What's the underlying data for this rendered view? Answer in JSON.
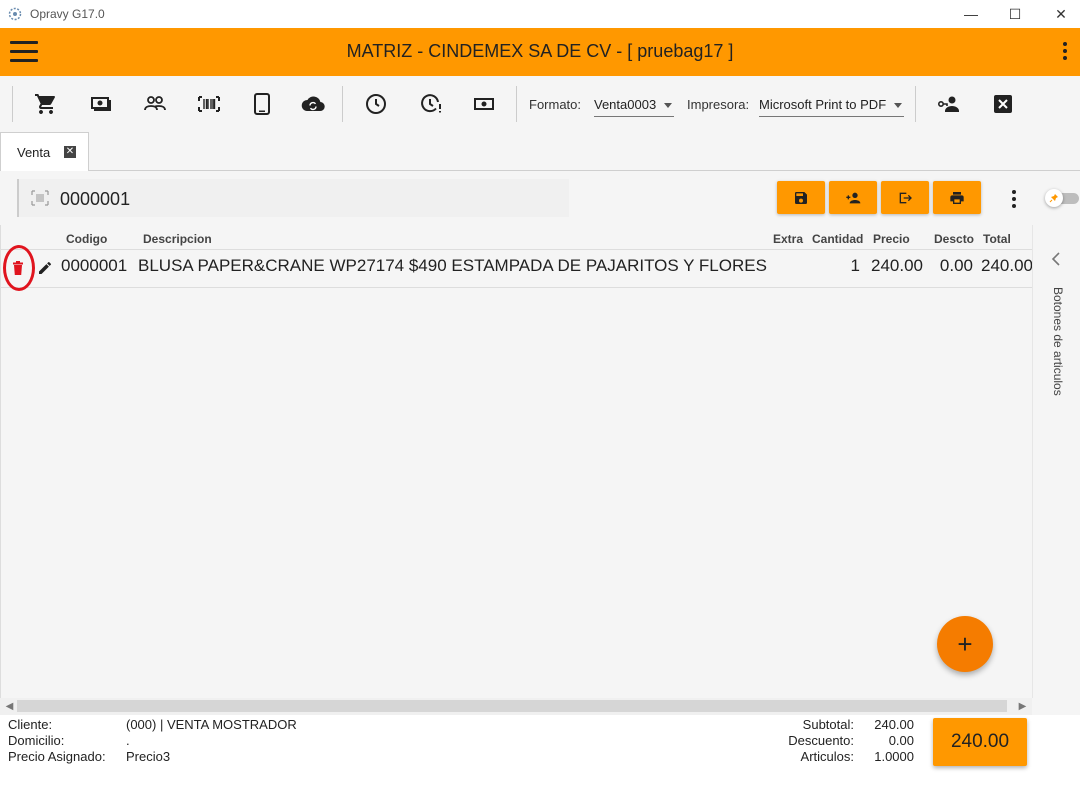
{
  "window": {
    "app_title": "Opravy G17.0",
    "minimize": "—",
    "maximize": "☐",
    "close": "✕"
  },
  "header": {
    "title": "MATRIZ - CINDEMEX SA DE CV - [ pruebag17 ]"
  },
  "toolbar": {
    "format_label": "Formato:",
    "format_value": "Venta0003",
    "printer_label": "Impresora:",
    "printer_value": "Microsoft Print to PDF",
    "icons": [
      "cart-icon",
      "cash-icon",
      "customers-icon",
      "barcode-icon",
      "tablet-icon",
      "cloud-sync-icon",
      "clock-icon",
      "clock-alert-icon",
      "money-icon",
      "user-key-icon",
      "close-box-icon"
    ]
  },
  "tabs": [
    {
      "label": "Venta",
      "close": "✕"
    }
  ],
  "search": {
    "value": "0000001"
  },
  "grid": {
    "columns": [
      "Codigo",
      "Descripcion",
      "Extra",
      "Cantidad",
      "Precio",
      "Descto",
      "Total"
    ],
    "rows": [
      {
        "codigo": "0000001",
        "descripcion": "BLUSA PAPER&CRANE WP27174 $490 ESTAMPADA DE PAJARITOS Y FLORES",
        "extra": "",
        "cantidad": "1",
        "precio": "240.00",
        "descto": "0.00",
        "total": "240.00"
      }
    ]
  },
  "side_panel": {
    "label": "Botones de articulos"
  },
  "fab": {
    "symbol": "+"
  },
  "footer": {
    "cliente_label": "Cliente:",
    "cliente_value": "(000) | VENTA MOSTRADOR",
    "domicilio_label": "Domicilio:",
    "domicilio_value": ".",
    "precio_label": "Precio Asignado:",
    "precio_value": "Precio3",
    "subtotal_label": "Subtotal:",
    "subtotal_value": "240.00",
    "descuento_label": "Descuento:",
    "descuento_value": "0.00",
    "articulos_label": "Articulos:",
    "articulos_value": "1.0000",
    "total": "240.00"
  },
  "colors": {
    "accent": "#ff9800",
    "fab": "#f57c00",
    "delete": "#e0141e"
  }
}
